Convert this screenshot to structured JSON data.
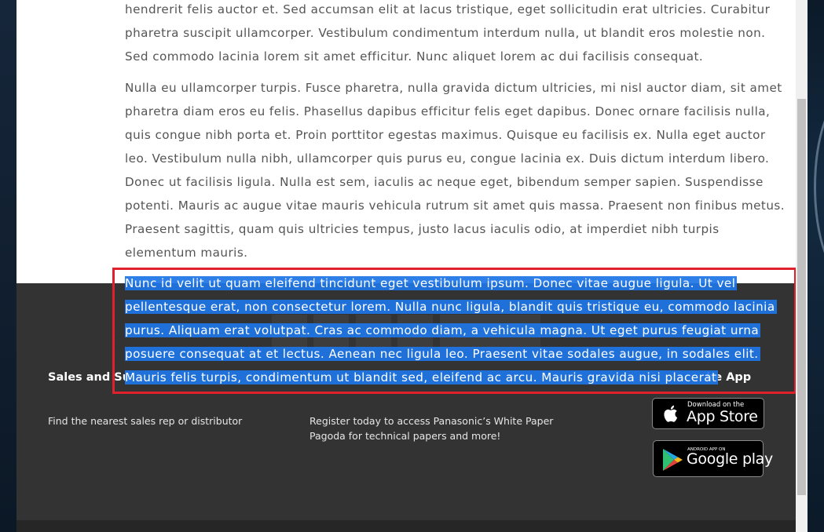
{
  "article": {
    "paragraph_1": "hendrerit felis auctor et. Sed accumsan elit at lacus tristique, eget sollicitudin erat ultricies. Curabitur pharetra suscipit ullamcorper. Vestibulum condimentum interdum nulla, ut blandit eros molestie non. Sed commodo lacinia lorem sit amet efficitur. Nunc aliquet lorem ac dui facilisis consequat.",
    "paragraph_2": "Nulla eu ullamcorper turpis. Fusce pharetra, nulla gravida dictum ultricies, mi nisl auctor diam, sit amet pharetra diam eros eu felis. Phasellus dapibus efficitur felis eget dapibus. Donec ornare facilisis nulla, quis congue nibh porta et. Proin porttitor egestas maximus. Quisque eu facilisis ex. Nulla eget auctor leo. Vestibulum nulla nibh, ullamcorper quis purus eu, congue lacinia ex. Duis dictum interdum libero. Donec ut facilisis ligula. Nulla est sem, iaculis ac neque eget, bibendum semper sapien. Suspendisse potenti. Mauris ac augue vitae mauris vehicula rutrum sit amet quis massa. Praesent non finibus metus. Praesent sagittis, quam quis ultricies tempus, justo lacus iaculis odio, at imperdiet nibh turpis elementum mauris.",
    "selected_lines": [
      "Nunc id velit ut quam eleifend tincidunt eget vestibulum ipsum. Donec vitae augue ligula. Ut vel",
      "pellentesque erat, non consectetur lorem. Nulla nunc ligula, blandit quis tristique eu, commodo lacinia",
      "purus. Aliquam erat volutpat. Cras ac commodo diam, a vehicula magna. Ut eget purus feugiat urna",
      "posuere consequat at et lectus. Aenean nec ligula leo. Praesent vitae sodales augue, in sodales elit.",
      "Mauris felis turpis, condimentum ut blandit sed, eleifend ac arcu. Mauris gravida nisi placerat"
    ]
  },
  "footer": {
    "sales_heading": "Sales and Su",
    "sales_text": "Find the nearest sales rep or distributor",
    "register_text": "Register today to access Panasonic’s White Paper Pagoda for technical papers and more!",
    "app_heading_fragment": "he App",
    "app_store": {
      "small": "Download on the",
      "big": "App Store"
    },
    "google_play": {
      "small": "ANDROID APP ON",
      "big": "Google play"
    }
  },
  "colors": {
    "selection": "#1e76e6",
    "highlight_box": "#e0202b",
    "footer_bg": "#333333"
  }
}
